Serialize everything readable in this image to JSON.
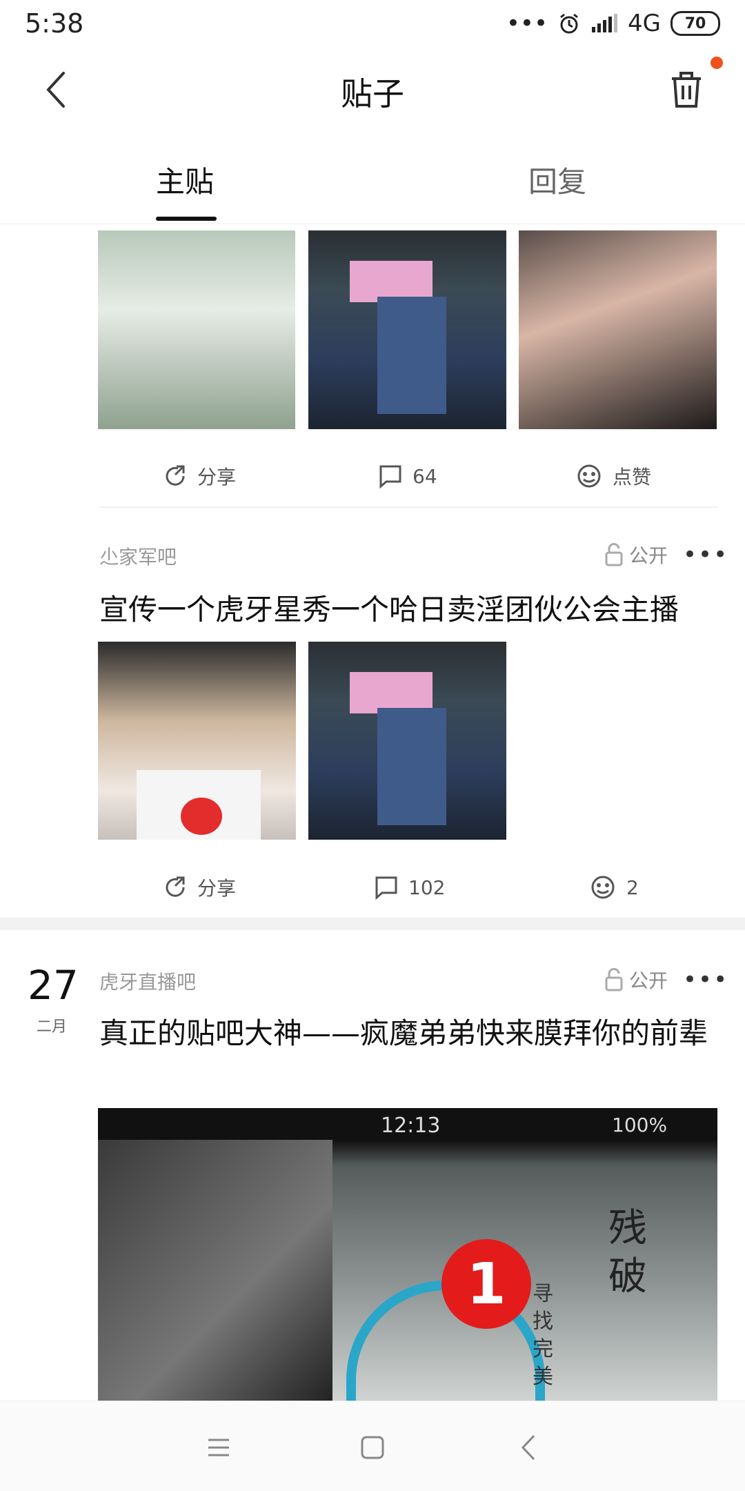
{
  "status_bar": {
    "time": "5:38",
    "dots": "•••",
    "network": "4G",
    "battery": "70"
  },
  "header": {
    "title": "贴子"
  },
  "tabs": [
    {
      "label": "主贴"
    },
    {
      "label": "回复"
    }
  ],
  "posts": [
    {
      "actions": {
        "share": "分享",
        "comments": "64",
        "likes": "点赞"
      }
    },
    {
      "forum": "尐家军吧",
      "visibility": "公开",
      "more": "•••",
      "title": "宣传一个虎牙星秀一个哈日卖淫团伙公会主播",
      "actions": {
        "share": "分享",
        "comments": "102",
        "likes": "2"
      }
    },
    {
      "date_day": "27",
      "date_month": "二月",
      "forum": "虎牙直播吧",
      "visibility": "公开",
      "more": "•••",
      "title": "真正的贴吧大神——疯魔弟弟快来膜拜你的前辈",
      "image": {
        "status_time": "12:13",
        "battery_text": "100%",
        "badge": "1",
        "text_big": "残破",
        "text_small": "寻找完美"
      }
    }
  ],
  "colors": {
    "accent_dot": "#f0501e",
    "divider": "#f0f0f0"
  }
}
